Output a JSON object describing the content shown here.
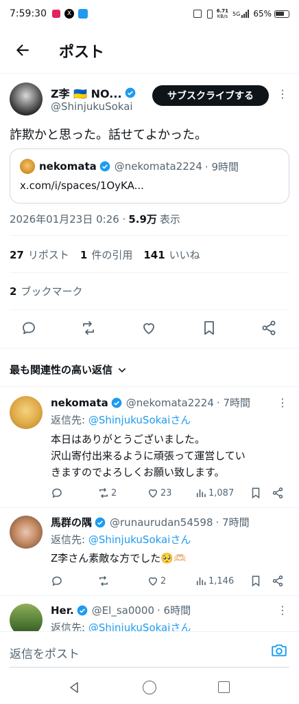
{
  "status_bar": {
    "time": "7:59:30",
    "speed_top": "6.71",
    "speed_unit": "KB/s",
    "net": "5G",
    "battery": "65%"
  },
  "header": {
    "title": "ポスト"
  },
  "post": {
    "display_name": "Z李 🇺🇦 NO...",
    "handle": "@ShinjukuSokai",
    "subscribe_label": "サブスクライブする",
    "text": "詐欺かと思った。話せてよかった。",
    "quote": {
      "name": "nekomata",
      "handle": "@nekomata2224",
      "time": "· 9時間",
      "text": "x.com/i/spaces/1OyKA..."
    },
    "datetime": "2026年01月23日 0:26 ·",
    "views": "5.9万",
    "views_label": "表示",
    "reposts_count": "27",
    "reposts_label": "リポスト",
    "quotes_count": "1",
    "quotes_label": "件の引用",
    "likes_count": "141",
    "likes_label": "いいね",
    "bookmarks_count": "2",
    "bookmarks_label": "ブックマーク"
  },
  "replies_sort": "最も関連性の高い返信",
  "replies": [
    {
      "name": "nekomata",
      "handle": "@nekomata2224",
      "time": "· 7時間",
      "reply_to_prefix": "返信先: ",
      "reply_to": "@ShinjukuSokaiさん",
      "text_lines": [
        "本日はありがとうございました。",
        "沢山寄付出来るように頑張って運営してい",
        "きますのでよろしくお願い致します。"
      ],
      "retweets": "2",
      "likes": "23",
      "views": "1,087"
    },
    {
      "name": "馬群の隅",
      "handle": "@runaurudan54598",
      "time": "· 7時間",
      "reply_to_prefix": "返信先: ",
      "reply_to": "@ShinjukuSokaiさん",
      "text_lines": [
        "Z李さん素敵な方でした🥺🫶🏻"
      ],
      "retweets": "",
      "likes": "2",
      "views": "1,146"
    },
    {
      "name": "Her.",
      "handle": "@El_sa0000",
      "time": "· 6時間",
      "reply_to_prefix": "返信先: ",
      "reply_to": "@ShinjukuSokaiさん",
      "text_lines": []
    }
  ],
  "composer": {
    "placeholder": "返信をポスト"
  },
  "colors": {
    "accent": "#1d9bf0",
    "text": "#0f1419",
    "muted": "#536471",
    "divider": "#eff3f4"
  }
}
